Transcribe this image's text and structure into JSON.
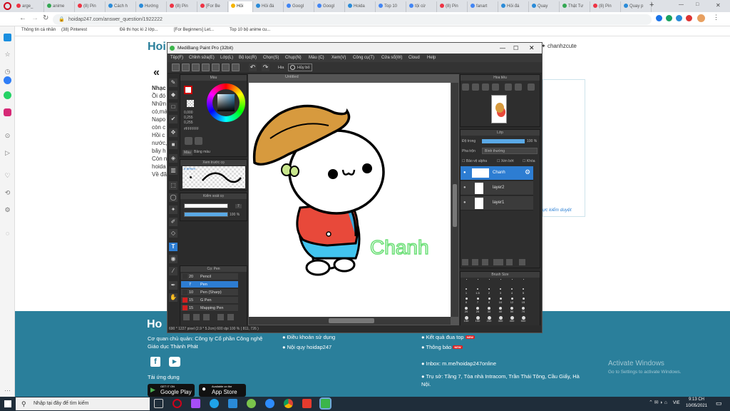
{
  "browser": {
    "tabs": [
      "arge_",
      "anime",
      "(8) Pin",
      "Cách h",
      "Hướng",
      "(8) Pin",
      "[For Be",
      "Hỏi",
      "Hỏi đá",
      "Googl",
      "Googl",
      "Hoida",
      "Top 10",
      "tội cừ",
      "(8) Pin",
      "fanart",
      "Hỏi đá",
      "Quay",
      "Thật Tư",
      "(8) Pin",
      "Quay p"
    ],
    "active_tab_index": 7,
    "new_tab": "+",
    "url": "hoidap247.com/answer_question/1922222",
    "bookmarks": [
      "Thông tin cá nhân",
      "(38) Pinterest",
      "Đề thi học kì 2 lớp...",
      "[For Beginners] Let...",
      "Top 10 bộ anime cu..."
    ],
    "window_controls": [
      "—",
      "□",
      "✕"
    ]
  },
  "site": {
    "logo": "Hoi",
    "user": "chanhzcute",
    "left_text": [
      "Nhạc",
      "Ồi đó",
      "Nhữn",
      "có,mà",
      "Napo",
      "còn c",
      "Hồi c",
      "nước,",
      "bây h",
      "Còn n",
      "hoida",
      "Về đã"
    ],
    "back_arrow": "«",
    "verify_link": "ực kiểm duyệt"
  },
  "footer": {
    "logo": "Ho",
    "company": "Cơ quan chủ quản: Công ty Cổ phần Công nghệ",
    "company2": "Giáo dục Thành Phát",
    "terms": "Điều khoản sử dụng",
    "rules": "Nội quy hoidap247",
    "top_results": "Kết quả đua top",
    "notify": "Thông báo",
    "new_badge": "NEW",
    "download": "Tải ứng dụng",
    "google_play": "Google Play",
    "gp_small": "GET IT ON",
    "app_store": "App Store",
    "as_small": "Available on the",
    "inbox": "Inbox: m.me/hoidap247online",
    "address": "Trụ sở: Tầng 7, Tòa nhà Intracom, Trần Thái Tông, Cầu Giấy, Hà",
    "address2": "Nội.",
    "activate_title": "Activate Windows",
    "activate_sub": "Go to Settings to activate Windows."
  },
  "medibang": {
    "title": "MediBang Paint Pro (32bit)",
    "menu": [
      "Tệp(F)",
      "Chỉnh sửa(E)",
      "Lớp(L)",
      "Bộ lọc(R)",
      "Chọn(S)",
      "Chụp(N)",
      "Màu (C)",
      "Xem(V)",
      "Công cụ(T)",
      "Cửa sổ(W)",
      "Cloud",
      "Help"
    ],
    "toolbar_hand": "Hia",
    "toolbar_cancel": "Hủy bỏ",
    "doc_tab": "Untitled",
    "color_panel": "Màu",
    "color_values": [
      "0,000",
      "0,255",
      "0,255"
    ],
    "hex": "#FFFFFF",
    "color_tabs": [
      "Màu",
      "Bảng màu"
    ],
    "brush_preview": "Xem trước cọ",
    "brush_size_label": "5,00mm",
    "brush_control": "Kiểm soát cọ",
    "brush_size_value": "7",
    "opacity_value": "100 %",
    "brush_panel": "Cọ: Pen",
    "brushes": [
      {
        "size": "20",
        "name": "Pencil",
        "color": "#333"
      },
      {
        "size": "7",
        "name": "Pen",
        "color": "#2d7dd2"
      },
      {
        "size": "10",
        "name": "Pen (Sharp)",
        "color": "#333"
      },
      {
        "size": "15",
        "name": "G Pen",
        "color": "#d02020"
      },
      {
        "size": "15",
        "name": "Mapping Pen",
        "color": "#d02020"
      }
    ],
    "nav_panel": "Hoa tiêu",
    "layer_panel": "Lớp",
    "opacity_label": "Độ trong",
    "layer_opacity": "100 %",
    "blend_label": "Pha trộn",
    "blend_value": "Bình thường",
    "protect_alpha": "Bảo vệ alpha",
    "clipping": "Xén bớt",
    "lock": "Khóa",
    "layers": [
      "Chanh",
      "layer2",
      "layer1"
    ],
    "brush_size_panel": "Brush Size",
    "sizes": [
      "",
      "",
      "",
      "",
      "",
      "",
      "1",
      "1.5",
      "2",
      "3",
      "4",
      "5",
      "6",
      "7",
      "8",
      "10",
      "12",
      "15",
      "20",
      "25",
      "30",
      "40",
      "50",
      "70",
      "100",
      "150",
      "200",
      "300",
      "400",
      "500",
      "700",
      "1000"
    ],
    "canvas_text": "Chanh",
    "status": "690 * 1227 pixel  (2.9 * 5.2cm)  600 dpi  100 %  ( 811, 726 )"
  },
  "taskbar": {
    "search_placeholder": "Nhập tại đây để tìm kiếm",
    "time": "9:13 CH",
    "date": "10/05/2021",
    "lang": "VIE"
  }
}
